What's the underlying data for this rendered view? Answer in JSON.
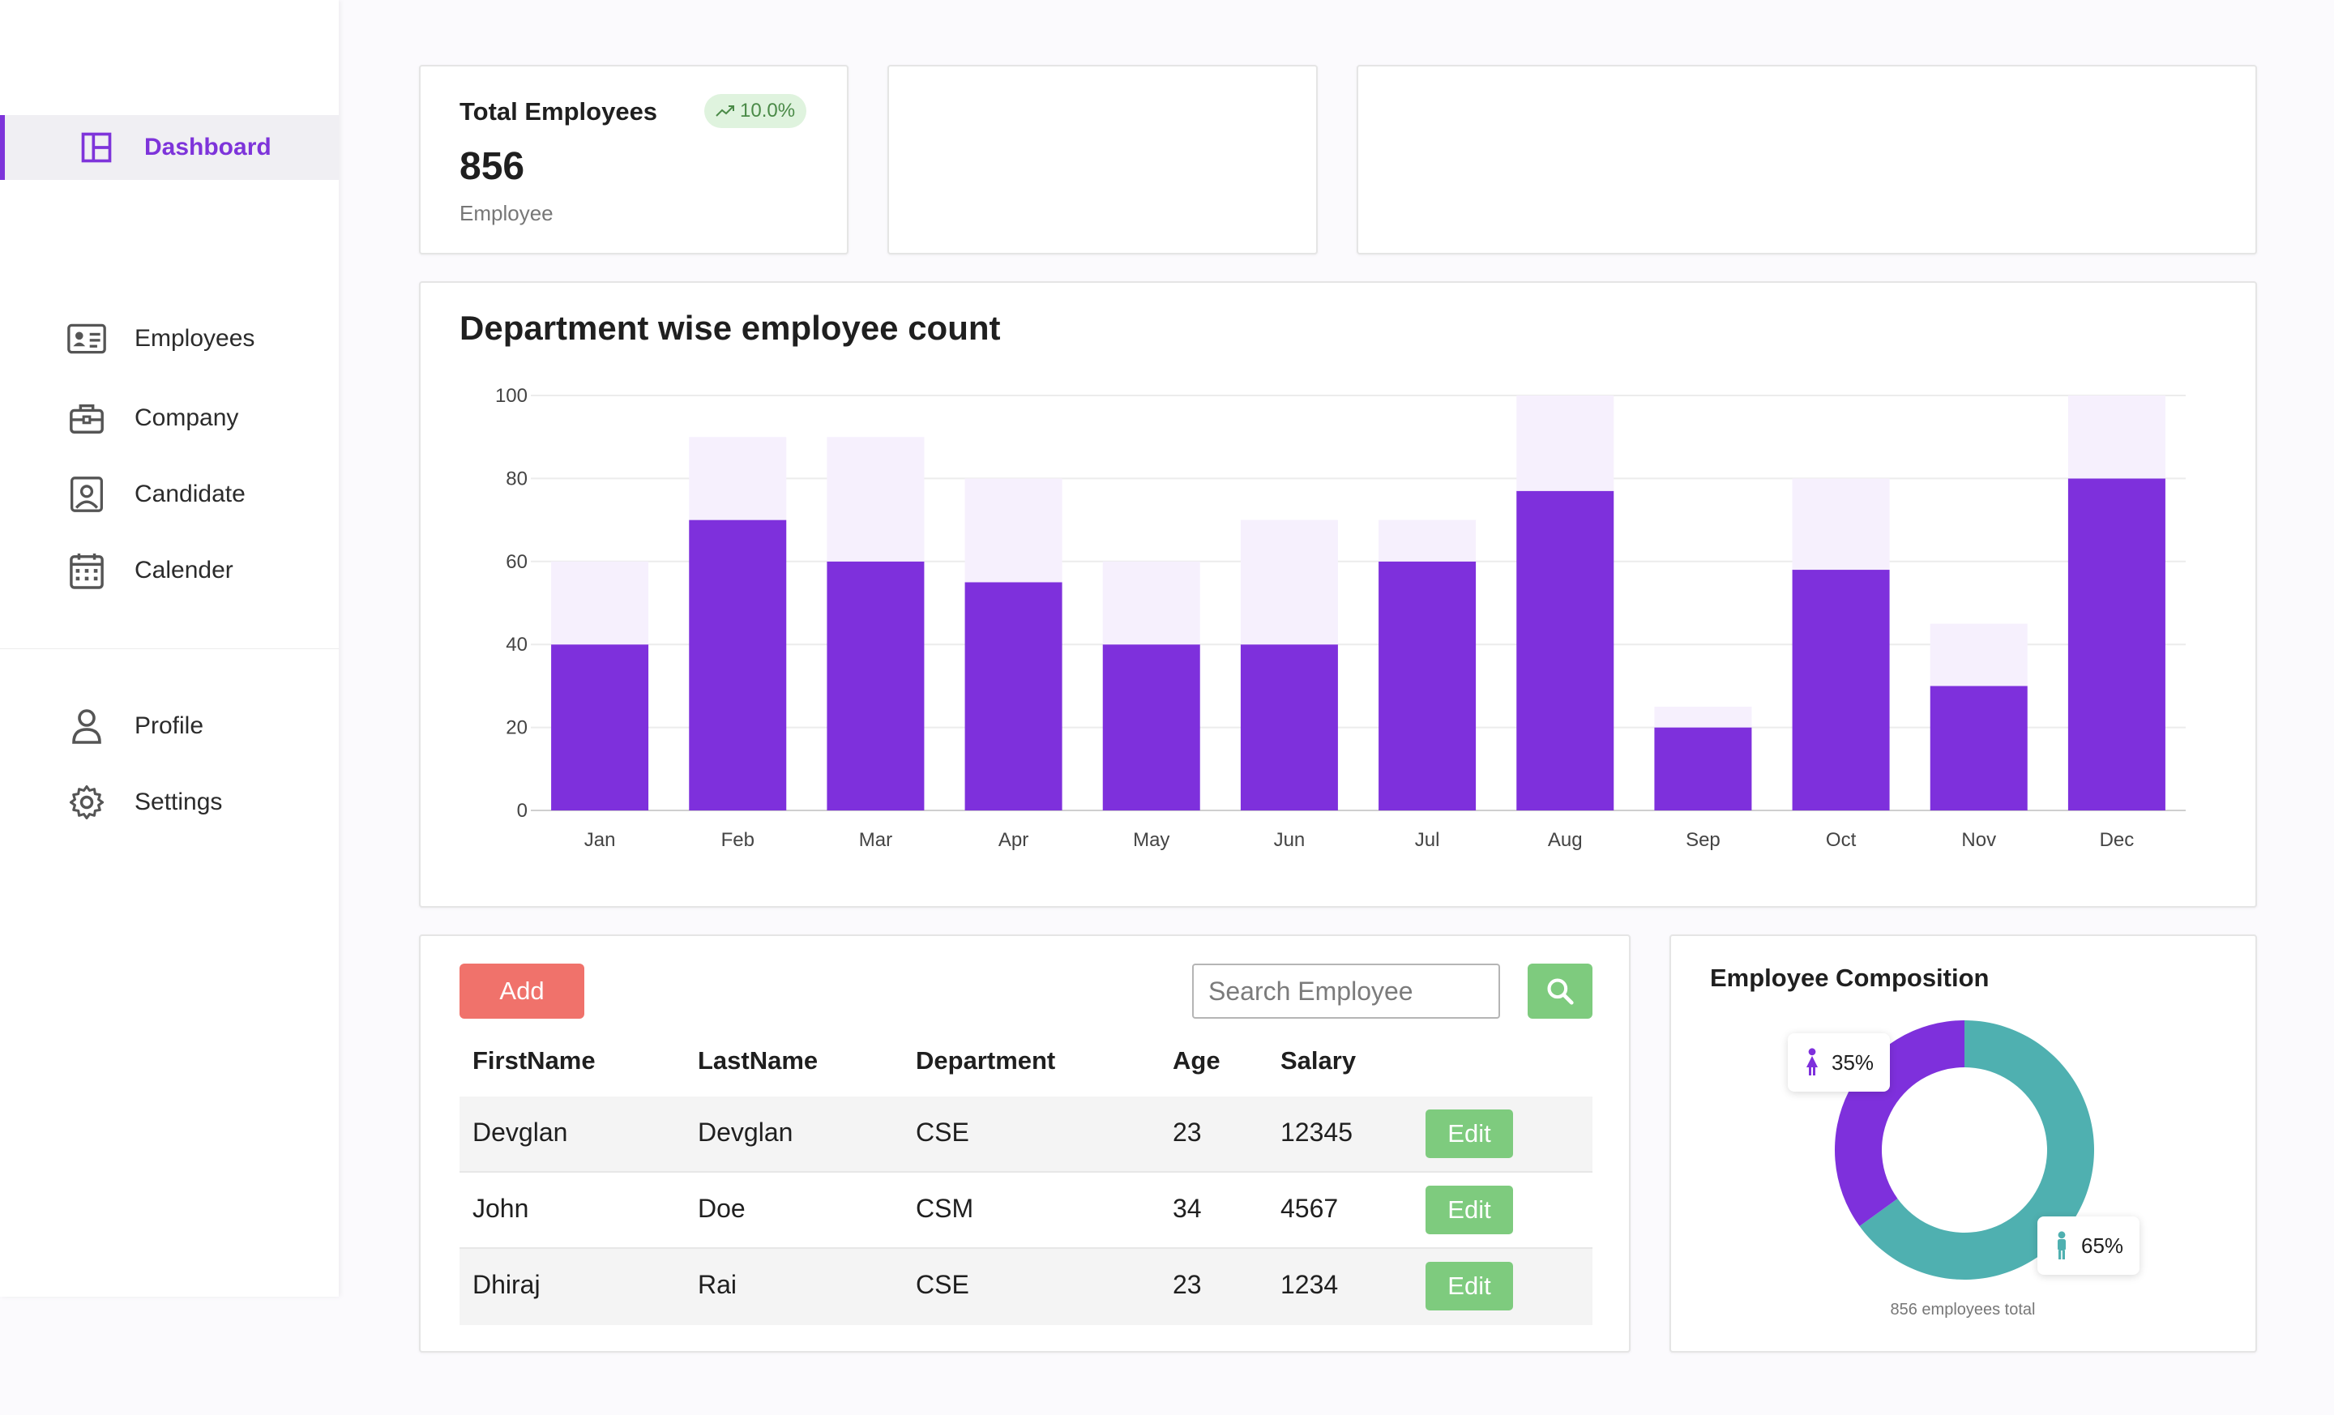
{
  "sidebar": {
    "items": [
      {
        "label": "Dashboard",
        "icon": "dashboard-icon",
        "active": true
      },
      {
        "label": "Employees",
        "icon": "id-card-icon"
      },
      {
        "label": "Company",
        "icon": "briefcase-icon"
      },
      {
        "label": "Candidate",
        "icon": "user-badge-icon"
      },
      {
        "label": "Calender",
        "icon": "calendar-icon"
      },
      {
        "label": "Profile",
        "icon": "person-icon"
      },
      {
        "label": "Settings",
        "icon": "gear-icon"
      }
    ]
  },
  "stats": {
    "title": "Total Employees",
    "badge": "10.0%",
    "value": "856",
    "subtitle": "Employee"
  },
  "chart_title": "Department wise employee count",
  "chart_data": {
    "type": "bar",
    "stacked": true,
    "categories": [
      "Jan",
      "Feb",
      "Mar",
      "Apr",
      "May",
      "Jun",
      "Jul",
      "Aug",
      "Sep",
      "Oct",
      "Nov",
      "Dec"
    ],
    "series": [
      {
        "values": [
          40,
          70,
          60,
          55,
          40,
          40,
          60,
          77,
          20,
          58,
          30,
          80
        ],
        "color": "#7e30dc"
      },
      {
        "values": [
          20,
          20,
          30,
          25,
          20,
          30,
          10,
          23,
          5,
          22,
          15,
          20
        ],
        "color": "#f6f0fd"
      }
    ],
    "yticks": [
      0,
      20,
      40,
      60,
      80,
      100
    ],
    "ylim": [
      0,
      100
    ],
    "grid": true
  },
  "table": {
    "add_label": "Add",
    "search_placeholder": "Search Employee",
    "headers": [
      "FirstName",
      "LastName",
      "Department",
      "Age",
      "Salary"
    ],
    "rows": [
      {
        "first": "Devglan",
        "last": "Devglan",
        "dept": "CSE",
        "age": "23",
        "salary": "12345",
        "action": "Edit"
      },
      {
        "first": "John",
        "last": "Doe",
        "dept": "CSM",
        "age": "34",
        "salary": "4567",
        "action": "Edit"
      },
      {
        "first": "Dhiraj",
        "last": "Rai",
        "dept": "CSE",
        "age": "23",
        "salary": "1234",
        "action": "Edit"
      }
    ]
  },
  "composition": {
    "title": "Employee Composition",
    "female_pct": "35%",
    "male_pct": "65%",
    "female_value": 35,
    "male_value": 65,
    "female_color": "#7e30dc",
    "male_color": "#4fb0b0",
    "footer": "856 employees total"
  }
}
